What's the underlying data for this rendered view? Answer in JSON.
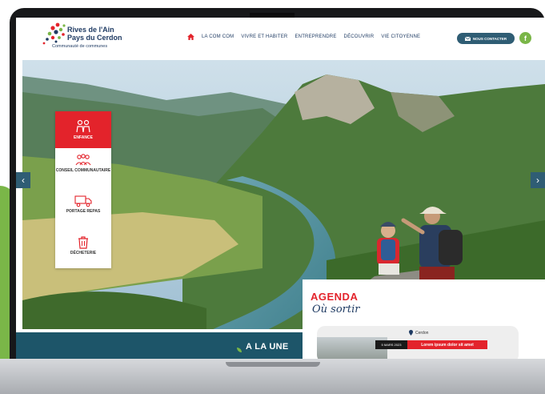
{
  "brand": {
    "name_line1": "Rives de l'Ain",
    "name_line2": "Pays du Cerdon",
    "subtitle": "Communauté de communes"
  },
  "nav": {
    "home_icon": "home-icon",
    "items": [
      "LA COM COM",
      "VIVRE ET HABITER",
      "ENTREPRENDRE",
      "DÉCOUVRIR",
      "VIE CITOYENNE"
    ]
  },
  "header_actions": {
    "contact_label": "NOUS CONTACTER",
    "contact_icon": "mail-icon",
    "facebook_label": "f"
  },
  "hero": {
    "prev_label": "‹",
    "next_label": "›"
  },
  "quick_access": [
    {
      "label": "ENFANCE",
      "icon": "children-icon",
      "active": true
    },
    {
      "label": "CONSEIL COMMUNAUTAIRE",
      "icon": "council-icon",
      "active": false
    },
    {
      "label": "PORTAGE REPAS",
      "icon": "delivery-truck-icon",
      "active": false
    },
    {
      "label": "DÉCHETERIE",
      "icon": "trash-bin-icon",
      "active": false
    }
  ],
  "a_la_une": {
    "title": "A LA UNE"
  },
  "agenda": {
    "title": "AGENDA",
    "subtitle": "Où sortir",
    "event": {
      "location": "Cerdon",
      "date": "5 MARS 2023",
      "title": "Lorem ipsum dolor sit amet"
    }
  },
  "colors": {
    "accent_red": "#e3232b",
    "navy": "#1f3b63",
    "teal": "#1d5569",
    "green": "#7ab648"
  }
}
